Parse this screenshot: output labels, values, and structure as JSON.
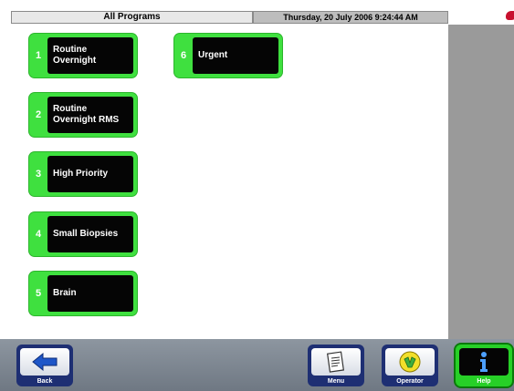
{
  "header": {
    "title": "All Programs",
    "datetime": "Thursday, 20 July 2006 9:24:44 AM"
  },
  "programs": [
    {
      "number": "1",
      "line1": "Routine",
      "line2": "Overnight"
    },
    {
      "number": "2",
      "line1": "Routine",
      "line2": "Overnight RMS"
    },
    {
      "number": "3",
      "line1": "High Priority",
      "line2": ""
    },
    {
      "number": "4",
      "line1": "Small Biopsies",
      "line2": ""
    },
    {
      "number": "5",
      "line1": "Brain",
      "line2": ""
    },
    {
      "number": "6",
      "line1": "Urgent",
      "line2": ""
    }
  ],
  "toolbar": {
    "back_label": "Back",
    "menu_label": "Menu",
    "operator_label": "Operator",
    "help_label": "Help"
  },
  "icons": {
    "back": "arrow-left-icon",
    "menu": "notepad-icon",
    "operator": "operator-badge-icon",
    "help": "info-icon",
    "status": "status-indicator-icon"
  },
  "colors": {
    "program_green": "#3fe03f",
    "program_black": "#050505",
    "toolbar_blue": "#1e2f73",
    "help_green": "#27d027"
  }
}
